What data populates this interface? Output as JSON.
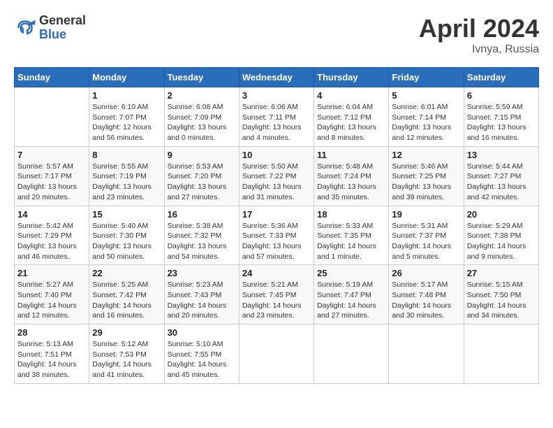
{
  "header": {
    "logo_general": "General",
    "logo_blue": "Blue",
    "month_year": "April 2024",
    "location": "Ivnya, Russia"
  },
  "calendar": {
    "weekdays": [
      "Sunday",
      "Monday",
      "Tuesday",
      "Wednesday",
      "Thursday",
      "Friday",
      "Saturday"
    ],
    "rows": [
      [
        {
          "day": "",
          "sunrise": "",
          "sunset": "",
          "daylight": ""
        },
        {
          "day": "1",
          "sunrise": "Sunrise: 6:10 AM",
          "sunset": "Sunset: 7:07 PM",
          "daylight": "Daylight: 12 hours and 56 minutes."
        },
        {
          "day": "2",
          "sunrise": "Sunrise: 6:08 AM",
          "sunset": "Sunset: 7:09 PM",
          "daylight": "Daylight: 13 hours and 0 minutes."
        },
        {
          "day": "3",
          "sunrise": "Sunrise: 6:06 AM",
          "sunset": "Sunset: 7:11 PM",
          "daylight": "Daylight: 13 hours and 4 minutes."
        },
        {
          "day": "4",
          "sunrise": "Sunrise: 6:04 AM",
          "sunset": "Sunset: 7:12 PM",
          "daylight": "Daylight: 13 hours and 8 minutes."
        },
        {
          "day": "5",
          "sunrise": "Sunrise: 6:01 AM",
          "sunset": "Sunset: 7:14 PM",
          "daylight": "Daylight: 13 hours and 12 minutes."
        },
        {
          "day": "6",
          "sunrise": "Sunrise: 5:59 AM",
          "sunset": "Sunset: 7:15 PM",
          "daylight": "Daylight: 13 hours and 16 minutes."
        }
      ],
      [
        {
          "day": "7",
          "sunrise": "Sunrise: 5:57 AM",
          "sunset": "Sunset: 7:17 PM",
          "daylight": "Daylight: 13 hours and 20 minutes."
        },
        {
          "day": "8",
          "sunrise": "Sunrise: 5:55 AM",
          "sunset": "Sunset: 7:19 PM",
          "daylight": "Daylight: 13 hours and 23 minutes."
        },
        {
          "day": "9",
          "sunrise": "Sunrise: 5:53 AM",
          "sunset": "Sunset: 7:20 PM",
          "daylight": "Daylight: 13 hours and 27 minutes."
        },
        {
          "day": "10",
          "sunrise": "Sunrise: 5:50 AM",
          "sunset": "Sunset: 7:22 PM",
          "daylight": "Daylight: 13 hours and 31 minutes."
        },
        {
          "day": "11",
          "sunrise": "Sunrise: 5:48 AM",
          "sunset": "Sunset: 7:24 PM",
          "daylight": "Daylight: 13 hours and 35 minutes."
        },
        {
          "day": "12",
          "sunrise": "Sunrise: 5:46 AM",
          "sunset": "Sunset: 7:25 PM",
          "daylight": "Daylight: 13 hours and 39 minutes."
        },
        {
          "day": "13",
          "sunrise": "Sunrise: 5:44 AM",
          "sunset": "Sunset: 7:27 PM",
          "daylight": "Daylight: 13 hours and 42 minutes."
        }
      ],
      [
        {
          "day": "14",
          "sunrise": "Sunrise: 5:42 AM",
          "sunset": "Sunset: 7:29 PM",
          "daylight": "Daylight: 13 hours and 46 minutes."
        },
        {
          "day": "15",
          "sunrise": "Sunrise: 5:40 AM",
          "sunset": "Sunset: 7:30 PM",
          "daylight": "Daylight: 13 hours and 50 minutes."
        },
        {
          "day": "16",
          "sunrise": "Sunrise: 5:38 AM",
          "sunset": "Sunset: 7:32 PM",
          "daylight": "Daylight: 13 hours and 54 minutes."
        },
        {
          "day": "17",
          "sunrise": "Sunrise: 5:36 AM",
          "sunset": "Sunset: 7:33 PM",
          "daylight": "Daylight: 13 hours and 57 minutes."
        },
        {
          "day": "18",
          "sunrise": "Sunrise: 5:33 AM",
          "sunset": "Sunset: 7:35 PM",
          "daylight": "Daylight: 14 hours and 1 minute."
        },
        {
          "day": "19",
          "sunrise": "Sunrise: 5:31 AM",
          "sunset": "Sunset: 7:37 PM",
          "daylight": "Daylight: 14 hours and 5 minutes."
        },
        {
          "day": "20",
          "sunrise": "Sunrise: 5:29 AM",
          "sunset": "Sunset: 7:38 PM",
          "daylight": "Daylight: 14 hours and 9 minutes."
        }
      ],
      [
        {
          "day": "21",
          "sunrise": "Sunrise: 5:27 AM",
          "sunset": "Sunset: 7:40 PM",
          "daylight": "Daylight: 14 hours and 12 minutes."
        },
        {
          "day": "22",
          "sunrise": "Sunrise: 5:25 AM",
          "sunset": "Sunset: 7:42 PM",
          "daylight": "Daylight: 14 hours and 16 minutes."
        },
        {
          "day": "23",
          "sunrise": "Sunrise: 5:23 AM",
          "sunset": "Sunset: 7:43 PM",
          "daylight": "Daylight: 14 hours and 20 minutes."
        },
        {
          "day": "24",
          "sunrise": "Sunrise: 5:21 AM",
          "sunset": "Sunset: 7:45 PM",
          "daylight": "Daylight: 14 hours and 23 minutes."
        },
        {
          "day": "25",
          "sunrise": "Sunrise: 5:19 AM",
          "sunset": "Sunset: 7:47 PM",
          "daylight": "Daylight: 14 hours and 27 minutes."
        },
        {
          "day": "26",
          "sunrise": "Sunrise: 5:17 AM",
          "sunset": "Sunset: 7:48 PM",
          "daylight": "Daylight: 14 hours and 30 minutes."
        },
        {
          "day": "27",
          "sunrise": "Sunrise: 5:15 AM",
          "sunset": "Sunset: 7:50 PM",
          "daylight": "Daylight: 14 hours and 34 minutes."
        }
      ],
      [
        {
          "day": "28",
          "sunrise": "Sunrise: 5:13 AM",
          "sunset": "Sunset: 7:51 PM",
          "daylight": "Daylight: 14 hours and 38 minutes."
        },
        {
          "day": "29",
          "sunrise": "Sunrise: 5:12 AM",
          "sunset": "Sunset: 7:53 PM",
          "daylight": "Daylight: 14 hours and 41 minutes."
        },
        {
          "day": "30",
          "sunrise": "Sunrise: 5:10 AM",
          "sunset": "Sunset: 7:55 PM",
          "daylight": "Daylight: 14 hours and 45 minutes."
        },
        {
          "day": "",
          "sunrise": "",
          "sunset": "",
          "daylight": ""
        },
        {
          "day": "",
          "sunrise": "",
          "sunset": "",
          "daylight": ""
        },
        {
          "day": "",
          "sunrise": "",
          "sunset": "",
          "daylight": ""
        },
        {
          "day": "",
          "sunrise": "",
          "sunset": "",
          "daylight": ""
        }
      ]
    ]
  }
}
